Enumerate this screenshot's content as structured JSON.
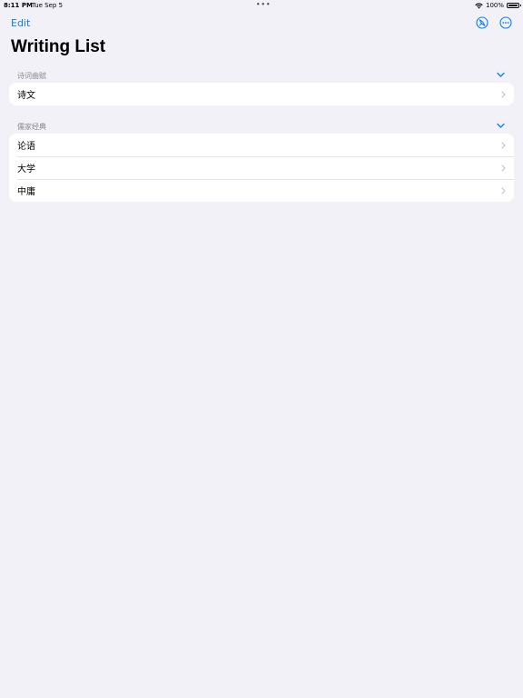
{
  "status": {
    "time": "8:11 PM",
    "date": "Tue Sep 5",
    "battery": "100%"
  },
  "nav": {
    "edit_label": "Edit"
  },
  "title": "Writing List",
  "sections": [
    {
      "title": "诗词曲赋",
      "items": [
        {
          "label": "诗文"
        }
      ]
    },
    {
      "title": "儒家经典",
      "items": [
        {
          "label": "论语"
        },
        {
          "label": "大学"
        },
        {
          "label": "中庸"
        }
      ]
    }
  ],
  "colors": {
    "accent": "#0a7aff",
    "background": "#f2f1f7",
    "section_text": "#8a8a8e"
  }
}
